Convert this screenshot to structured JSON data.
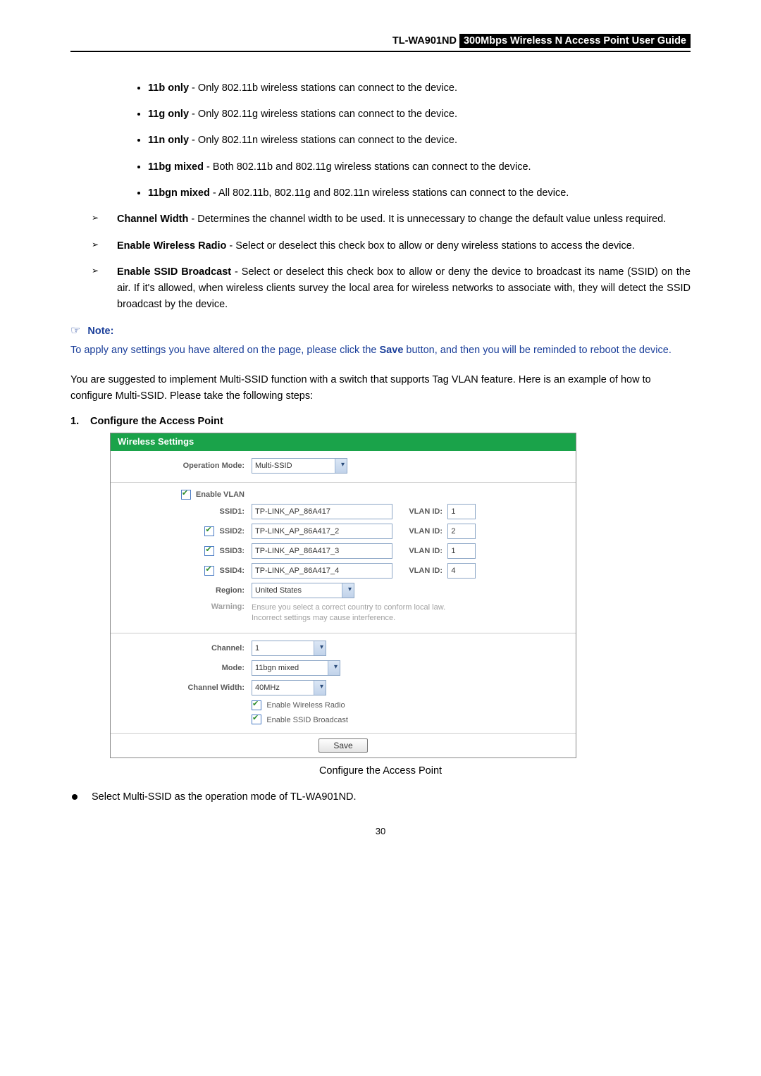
{
  "header": {
    "model": "TL-WA901ND",
    "title": "300Mbps Wireless N Access Point User Guide"
  },
  "modes": [
    {
      "name": "11b only",
      "desc": " - Only 802.11b wireless stations can connect to the device."
    },
    {
      "name": "11g only",
      "desc": " - Only 802.11g wireless stations can connect to the device."
    },
    {
      "name": "11n only",
      "desc": " - Only 802.11n wireless stations can connect to the device."
    },
    {
      "name": "11bg mixed",
      "desc": " - Both 802.11b and 802.11g wireless stations can connect to the device."
    },
    {
      "name": "11bgn mixed",
      "desc": " - All 802.11b, 802.11g and 802.11n wireless stations can connect to the device."
    }
  ],
  "arrowitems": [
    {
      "name": "Channel Width",
      "desc": " - Determines the channel width to be used. It is unnecessary to change the default value unless required."
    },
    {
      "name": "Enable Wireless Radio",
      "desc": " - Select or deselect this check box to allow or deny wireless stations to access the device."
    },
    {
      "name": "Enable SSID Broadcast",
      "desc": " - Select or deselect this check box to allow or deny the device to broadcast its name (SSID) on the air. If it's allowed, when wireless clients survey the local area for wireless networks to associate with, they will detect the SSID broadcast by the device."
    }
  ],
  "note": {
    "label": "Note:",
    "pre": "To apply any settings you have altered on the page, please click the ",
    "bold": "Save",
    "post": " button, and then you will be reminded to reboot the device."
  },
  "paras": [
    "You are suggested to implement Multi-SSID function with a switch that supports Tag VLAN feature. Here is an example of how to configure Multi-SSID. Please take the following steps:"
  ],
  "step": {
    "num": "1.",
    "title": "Configure the Access Point"
  },
  "shot": {
    "title": "Wireless Settings",
    "operationMode": {
      "label": "Operation Mode:",
      "value": "Multi-SSID"
    },
    "enableVlan": {
      "label": "Enable VLAN"
    },
    "ssidRows": [
      {
        "label": "SSID1:",
        "cb": false,
        "value": "TP-LINK_AP_86A417",
        "vlanLabel": "VLAN ID:",
        "vlan": "1"
      },
      {
        "label": "SSID2:",
        "cb": true,
        "value": "TP-LINK_AP_86A417_2",
        "vlanLabel": "VLAN ID:",
        "vlan": "2"
      },
      {
        "label": "SSID3:",
        "cb": true,
        "value": "TP-LINK_AP_86A417_3",
        "vlanLabel": "VLAN ID:",
        "vlan": "1"
      },
      {
        "label": "SSID4:",
        "cb": true,
        "value": "TP-LINK_AP_86A417_4",
        "vlanLabel": "VLAN ID:",
        "vlan": "4"
      }
    ],
    "region": {
      "label": "Region:",
      "value": "United States"
    },
    "warning": {
      "label": "Warning:",
      "line1": "Ensure you select a correct country to conform local law.",
      "line2": "Incorrect settings may cause interference."
    },
    "channel": {
      "label": "Channel:",
      "value": "1"
    },
    "mode": {
      "label": "Mode:",
      "value": "11bgn mixed"
    },
    "channelWidth": {
      "label": "Channel Width:",
      "value": "40MHz"
    },
    "cbRadio": "Enable Wireless Radio",
    "cbBroadcast": "Enable SSID Broadcast",
    "save": "Save"
  },
  "caption": "Configure the Access Point",
  "finalBullet": "Select Multi-SSID as the operation mode of TL-WA901ND.",
  "pageNumber": "30"
}
